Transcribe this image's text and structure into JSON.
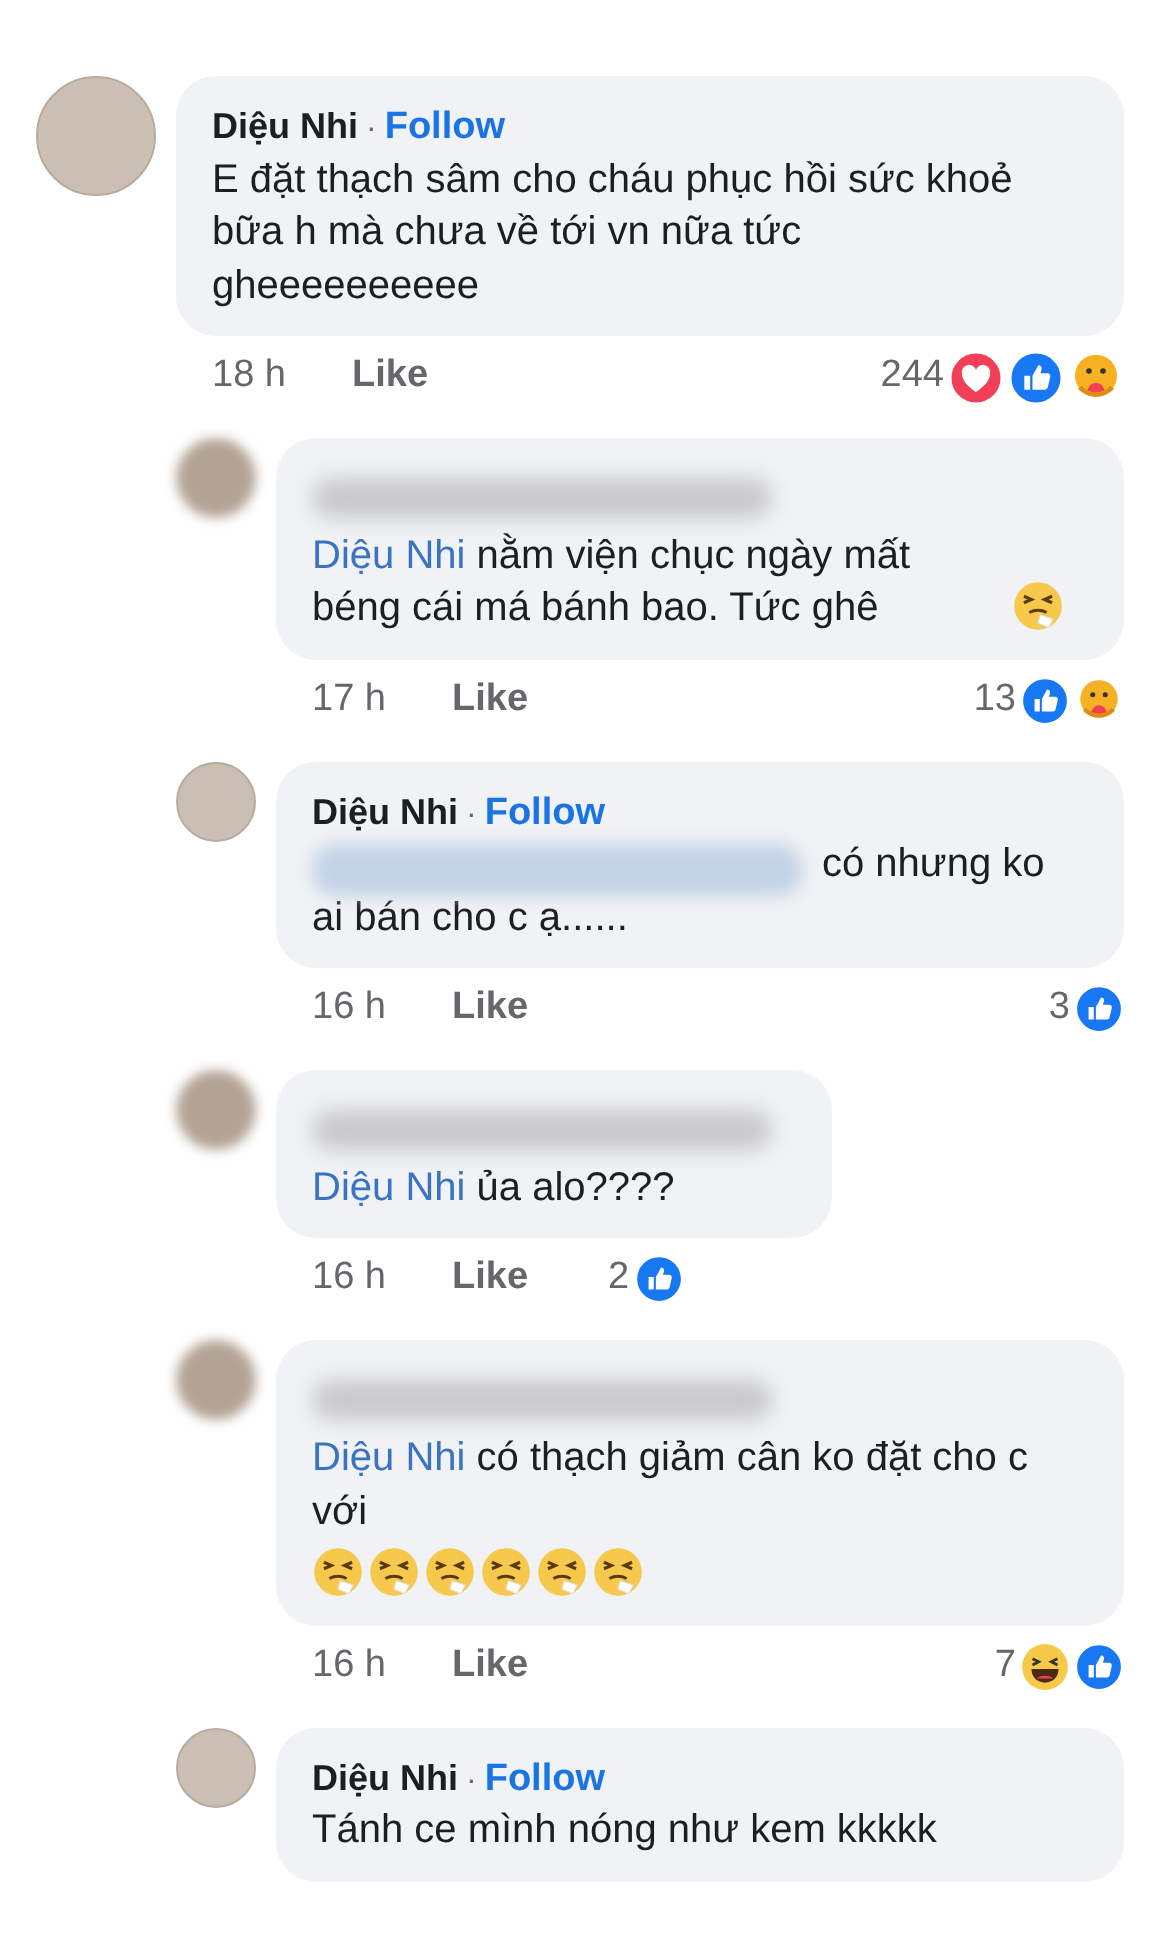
{
  "comments": [
    {
      "author": "Diệu Nhi",
      "author_hidden": false,
      "separator": "·",
      "follow": "Follow",
      "text": "E đặt thạch sâm cho cháu phục hồi sức khoẻ bữa h mà chưa về tới vn nữa tức gheeeeeeeeee",
      "time": "18 h",
      "like": "Like",
      "reaction_count": "244",
      "reactions": [
        {
          "kind": "love"
        },
        {
          "kind": "like"
        },
        {
          "kind": "care"
        }
      ],
      "children": [
        {
          "author_hidden": true,
          "mention": "Diệu Nhi",
          "text": "nằm viện chục ngày mất béng cái má bánh bao. Tức ghê",
          "emojis": [
            {
              "kind": "sneeze"
            }
          ],
          "time": "17 h",
          "like": "Like",
          "reaction_count": "13",
          "reactions": [
            {
              "kind": "like"
            },
            {
              "kind": "care"
            }
          ]
        },
        {
          "author": "Diệu Nhi",
          "author_hidden": false,
          "separator": "·",
          "follow": "Follow",
          "mention_hidden": true,
          "text": "có nhưng ko ai bán cho c ạ......",
          "time": "16 h",
          "like": "Like",
          "reaction_count": "3",
          "reactions": [
            {
              "kind": "like"
            }
          ]
        },
        {
          "author_hidden": true,
          "mention": "Diệu Nhi",
          "text": "ủa alo????",
          "time": "16 h",
          "like": "Like",
          "reaction_count": "2",
          "reactions": [
            {
              "kind": "like"
            }
          ]
        },
        {
          "author_hidden": true,
          "mention": "Diệu Nhi",
          "text": "có thạch giảm cân ko đặt cho c với",
          "emojis": [
            {
              "kind": "sneeze"
            },
            {
              "kind": "sneeze"
            },
            {
              "kind": "sneeze"
            },
            {
              "kind": "sneeze"
            },
            {
              "kind": "sneeze"
            },
            {
              "kind": "sneeze"
            }
          ],
          "time": "16 h",
          "like": "Like",
          "reaction_count": "7",
          "reactions": [
            {
              "kind": "haha"
            },
            {
              "kind": "like"
            }
          ]
        },
        {
          "author": "Diệu Nhi",
          "author_hidden": false,
          "separator": "·",
          "follow": "Follow",
          "text": "Tánh ce mình nóng như kem kkkkk"
        }
      ]
    }
  ]
}
